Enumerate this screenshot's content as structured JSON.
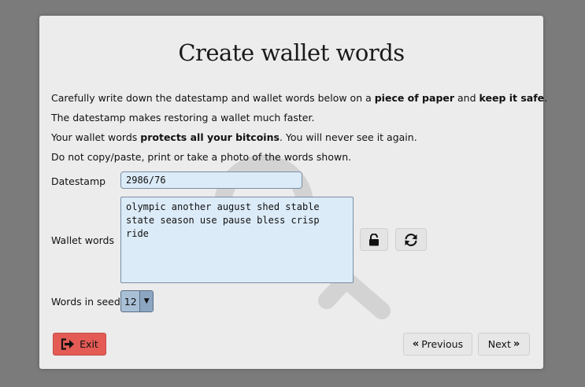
{
  "dialog": {
    "title": "Create wallet words",
    "instructions": {
      "line1_pre": "Carefully write down the datestamp and wallet words below on a ",
      "line1_bold1": "piece of paper",
      "line1_mid": " and ",
      "line1_bold2": "keep it safe",
      "line1_post": ".",
      "line2": "The datestamp makes restoring a wallet much faster.",
      "line3_pre": "Your wallet words ",
      "line3_bold": "protects all your bitcoins",
      "line3_post": ". You will never see it again.",
      "line4": "Do not copy/paste, print or take a photo of the words shown."
    },
    "datestamp": {
      "label": "Datestamp",
      "value": "2986/76"
    },
    "wallet_words": {
      "label": "Wallet words",
      "value": "olympic another august shed stable\nstate season use pause bless crisp\nride"
    },
    "seed": {
      "label": "Words in seed",
      "selected": "12"
    },
    "buttons": {
      "exit": "Exit",
      "previous": "Previous",
      "next": "Next"
    },
    "icons": {
      "lock": "unlock-icon",
      "refresh": "refresh-icon",
      "exit": "exit-icon",
      "prev": "double-chevron-left-icon",
      "next": "double-chevron-right-icon",
      "select": "caret-down-icon",
      "watermark": "key-watermark-icon"
    },
    "colors": {
      "exit_bg": "#e45b55",
      "field_bg": "#dcebf8",
      "select_bg": "#a9bfd6"
    }
  }
}
